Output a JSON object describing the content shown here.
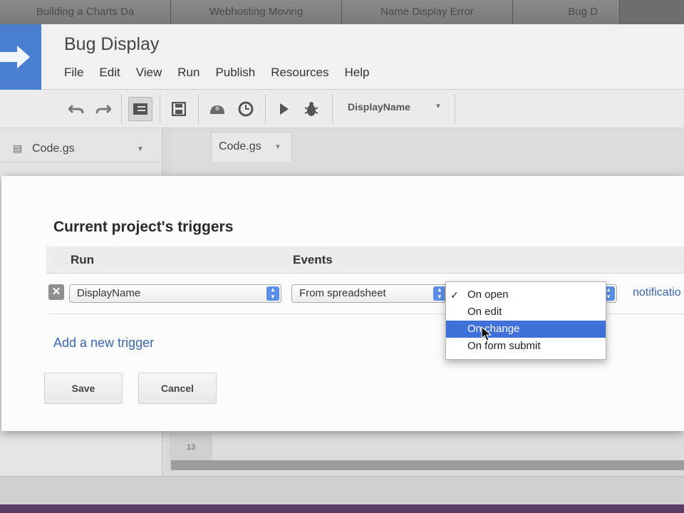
{
  "browser_tabs": [
    {
      "label": "Building a Charts Da"
    },
    {
      "label": "Webhosting Moving"
    },
    {
      "label": "Name Display Error"
    },
    {
      "label": "Bug D"
    }
  ],
  "app": {
    "title": "Bug Display",
    "menu": [
      "File",
      "Edit",
      "View",
      "Run",
      "Publish",
      "Resources",
      "Help"
    ]
  },
  "toolbar": {
    "function_select": "DisplayName",
    "icons": [
      "undo-icon",
      "redo-icon",
      "indent-icon",
      "save-icon",
      "triggers-icon",
      "history-icon",
      "run-icon",
      "debug-icon"
    ]
  },
  "sidebar": {
    "file": "Code.gs"
  },
  "editor": {
    "tab": "Code.gs",
    "line_number": "13"
  },
  "dialog": {
    "title": "Current project's triggers",
    "columns": {
      "run": "Run",
      "events": "Events"
    },
    "trigger": {
      "function": "DisplayName",
      "source": "From spreadsheet",
      "notifications_link": "notificatio"
    },
    "event_options": [
      {
        "label": "On open",
        "checked": true,
        "highlighted": false
      },
      {
        "label": "On edit",
        "checked": false,
        "highlighted": false
      },
      {
        "label": "On change",
        "checked": false,
        "highlighted": true
      },
      {
        "label": "On form submit",
        "checked": false,
        "highlighted": false
      }
    ],
    "add_trigger": "Add a new trigger",
    "save": "Save",
    "cancel": "Cancel"
  },
  "colors": {
    "accent": "#4a7fd0",
    "highlight": "#3f6fd8",
    "link": "#3a67b0"
  }
}
